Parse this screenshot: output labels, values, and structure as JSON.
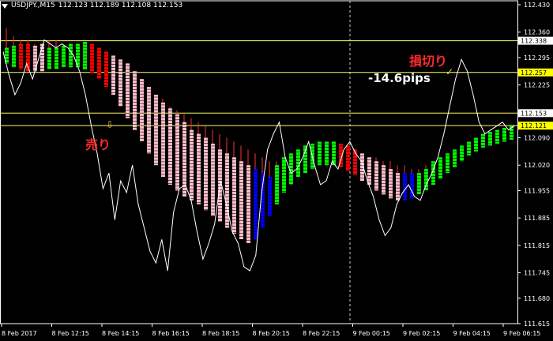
{
  "header": {
    "symbol": "USDJPY.,M15",
    "ohlc": "112.123 112.189 112.108 112.153"
  },
  "colors": {
    "background": "#000000",
    "axis": "#ffffff",
    "bull_strong": "#00ff00",
    "bull_weak": "#0000ff",
    "bear_strong": "#ff0000",
    "bear_weak": "#ffc0cb",
    "price_line": "#ffffff",
    "level_line": "#ffff66"
  },
  "annotations": {
    "sell": "売り",
    "stoploss": "損切り",
    "pips": "-14.6pips"
  },
  "chart_data": {
    "type": "candlestick",
    "ylim": [
      111.615,
      112.43
    ],
    "y_ticks": [
      "112.430",
      "112.360",
      "112.295",
      "112.225",
      "112.090",
      "112.020",
      "111.955",
      "111.885",
      "111.815",
      "111.745",
      "111.680",
      "111.615"
    ],
    "x_ticks": [
      "8 Feb 2017",
      "8 Feb 12:15",
      "8 Feb 14:15",
      "8 Feb 16:15",
      "8 Feb 18:15",
      "8 Feb 20:15",
      "8 Feb 22:15",
      "9 Feb 00:15",
      "9 Feb 02:15",
      "9 Feb 04:15",
      "9 Feb 06:15"
    ],
    "levels": [
      {
        "label": "112.338",
        "value": 112.338
      },
      {
        "label": "112.257",
        "value": 112.257
      },
      {
        "label": "112.153",
        "value": 112.153
      },
      {
        "label": "112.121",
        "value": 112.121
      }
    ],
    "bars_upper": [
      112.32,
      112.325,
      112.33,
      112.33,
      112.325,
      112.33,
      112.32,
      112.32,
      112.325,
      112.33,
      112.33,
      112.335,
      112.33,
      112.32,
      112.31,
      112.3,
      112.29,
      112.28,
      112.26,
      112.24,
      112.22,
      112.2,
      112.18,
      112.165,
      112.15,
      112.13,
      112.11,
      112.1,
      112.09,
      112.075,
      112.06,
      112.05,
      112.04,
      112.03,
      112.02,
      112.01,
      112.0,
      111.99,
      112.02,
      112.04,
      112.05,
      112.06,
      112.07,
      112.075,
      112.08,
      112.08,
      112.08,
      112.075,
      112.07,
      112.06,
      112.05,
      112.04,
      112.03,
      112.02,
      112.01,
      112.0,
      112.0,
      112.0,
      112.0,
      112.01,
      112.03,
      112.04,
      112.05,
      112.06,
      112.07,
      112.08,
      112.09,
      112.1,
      112.105,
      112.11,
      112.115,
      112.12
    ],
    "bars_lower": [
      112.28,
      112.27,
      112.265,
      112.26,
      112.26,
      112.26,
      112.265,
      112.265,
      112.27,
      112.27,
      112.27,
      112.265,
      112.255,
      112.24,
      112.22,
      112.2,
      112.17,
      112.14,
      112.11,
      112.08,
      112.05,
      112.02,
      111.99,
      111.97,
      111.955,
      111.94,
      111.93,
      111.92,
      111.905,
      111.89,
      111.875,
      111.86,
      111.845,
      111.83,
      111.82,
      111.83,
      111.86,
      111.89,
      111.92,
      111.95,
      111.97,
      111.99,
      112.0,
      112.01,
      112.02,
      112.02,
      112.02,
      112.015,
      112.005,
      111.995,
      111.98,
      111.97,
      111.955,
      111.945,
      111.935,
      111.93,
      111.93,
      111.935,
      111.945,
      111.955,
      111.97,
      111.985,
      112.0,
      112.015,
      112.03,
      112.045,
      112.055,
      112.065,
      112.07,
      112.075,
      112.08,
      112.085
    ],
    "bar_colors": [
      "bull_strong",
      "bull_strong",
      "bear_strong",
      "bear_strong",
      "bear_weak",
      "bear_weak",
      "bull_strong",
      "bull_strong",
      "bull_strong",
      "bull_strong",
      "bull_strong",
      "bull_strong",
      "bear_strong",
      "bear_strong",
      "bear_strong",
      "bear_weak",
      "bear_weak",
      "bear_weak",
      "bear_weak",
      "bear_weak",
      "bear_weak",
      "bear_weak",
      "bear_weak",
      "bear_weak",
      "bear_weak",
      "bear_weak",
      "bear_weak",
      "bear_weak",
      "bear_weak",
      "bear_weak",
      "bear_weak",
      "bear_weak",
      "bear_weak",
      "bear_weak",
      "bear_weak",
      "bull_weak",
      "bull_weak",
      "bull_weak",
      "bull_strong",
      "bull_strong",
      "bull_strong",
      "bull_strong",
      "bull_strong",
      "bull_strong",
      "bull_strong",
      "bull_strong",
      "bull_strong",
      "bear_strong",
      "bear_strong",
      "bear_strong",
      "bear_weak",
      "bear_weak",
      "bear_weak",
      "bear_weak",
      "bear_weak",
      "bear_weak",
      "bull_weak",
      "bull_weak",
      "bull_strong",
      "bull_strong",
      "bull_strong",
      "bull_strong",
      "bull_strong",
      "bull_strong",
      "bull_strong",
      "bull_strong",
      "bull_strong",
      "bull_strong",
      "bull_strong",
      "bull_strong",
      "bull_strong",
      "bull_strong"
    ],
    "red_overlay_upper": [
      112.37,
      112.35,
      112.34,
      112.34,
      112.33,
      112.33,
      112.34,
      112.34,
      112.33,
      112.33,
      112.33,
      112.33,
      112.31,
      112.3,
      112.29,
      112.28,
      112.27,
      112.26,
      112.24,
      112.23,
      112.22,
      112.2,
      112.19,
      112.17,
      112.16,
      112.15,
      112.14,
      112.13,
      112.12,
      112.11,
      112.1,
      112.09,
      112.08,
      112.07,
      112.06,
      112.05,
      112.04,
      112.03,
      112.03,
      112.04,
      112.05,
      112.06,
      112.07,
      112.07,
      112.07,
      112.07,
      112.07,
      112.06,
      112.06,
      112.05,
      112.05,
      112.04,
      112.04,
      112.03,
      112.03,
      112.02,
      112.02,
      112.01,
      112.01,
      112.02
    ],
    "price_line": [
      112.31,
      112.25,
      112.2,
      112.23,
      112.28,
      112.24,
      112.29,
      112.34,
      112.33,
      112.32,
      112.33,
      112.32,
      112.3,
      112.26,
      112.2,
      112.12,
      112.05,
      111.96,
      112.0,
      111.88,
      111.98,
      111.95,
      112.02,
      111.92,
      111.86,
      111.8,
      111.77,
      111.83,
      111.75,
      111.9,
      111.96,
      111.97,
      111.93,
      111.85,
      111.78,
      111.82,
      111.87,
      111.98,
      111.92,
      111.85,
      111.82,
      111.76,
      111.75,
      111.79,
      111.95,
      112.06,
      112.1,
      112.13,
      112.04,
      112.0,
      112.01,
      112.04,
      112.08,
      112.02,
      111.97,
      111.98,
      112.03,
      112.01,
      112.06,
      112.08,
      112.05,
      112.03,
      111.98,
      111.94,
      111.88,
      111.84,
      111.86,
      111.92,
      111.95,
      111.97,
      111.94,
      111.93,
      111.97,
      112.0,
      112.04,
      112.1,
      112.17,
      112.24,
      112.29,
      112.26,
      112.2,
      112.13,
      112.1,
      112.11,
      112.12,
      112.13,
      112.11,
      112.12
    ]
  }
}
